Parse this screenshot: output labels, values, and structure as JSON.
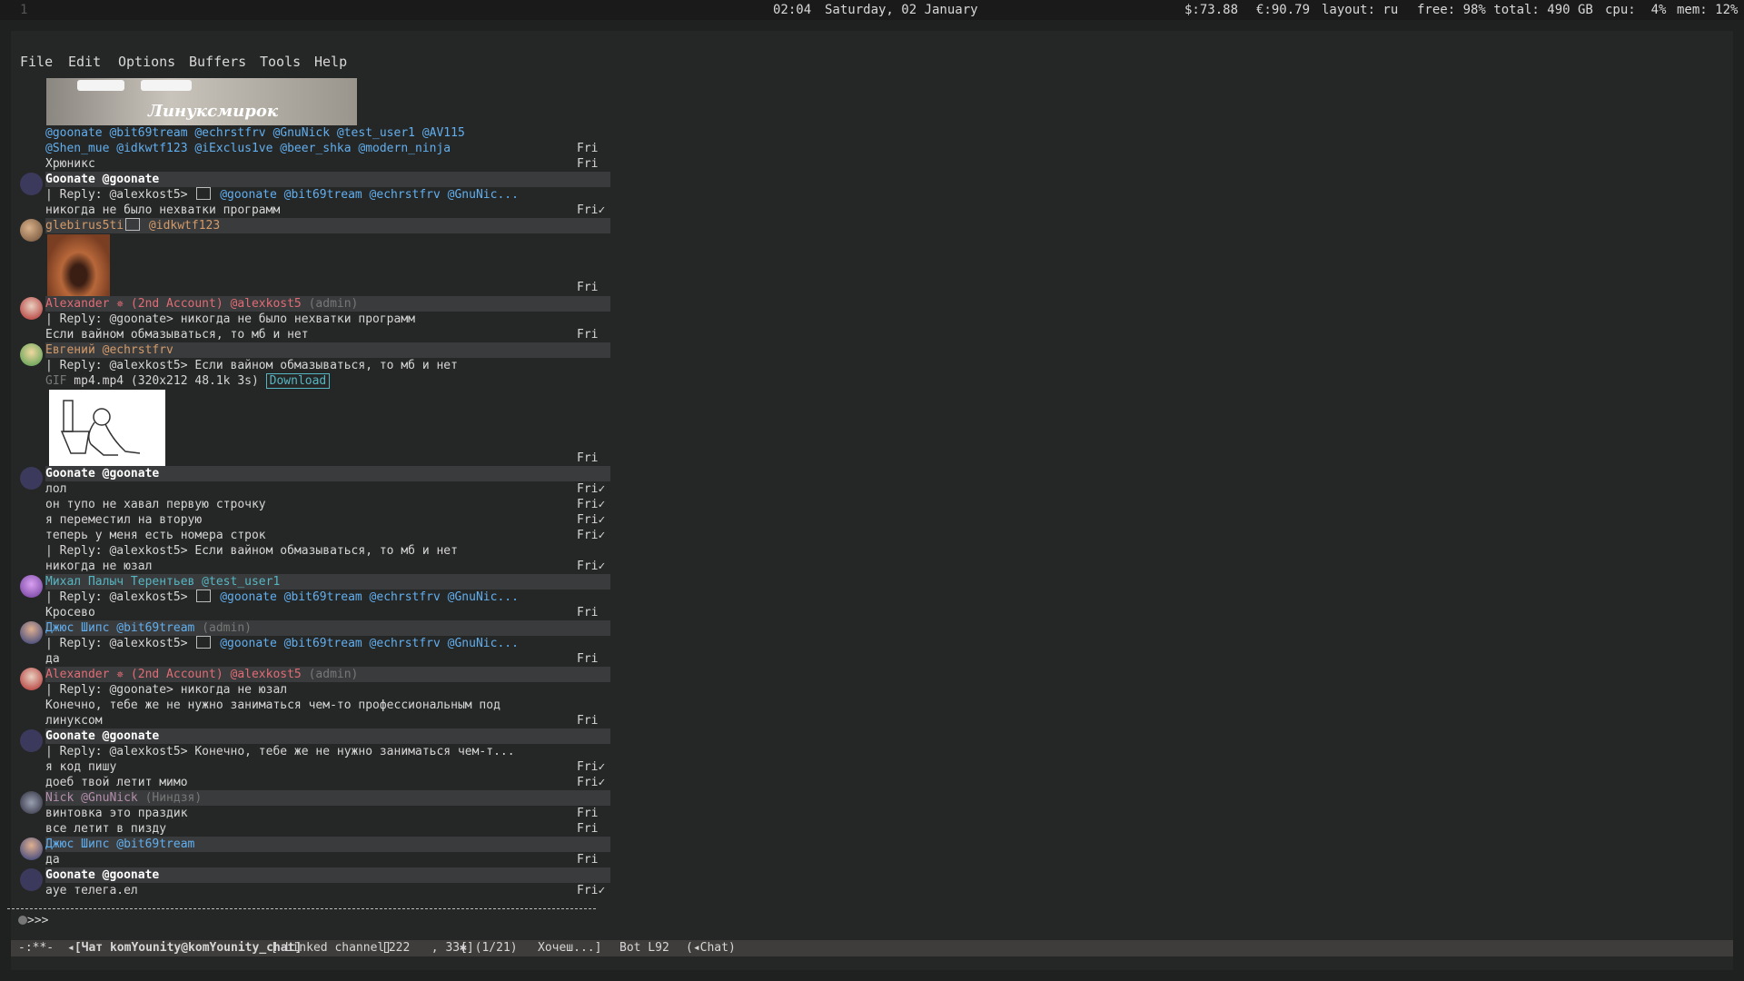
{
  "topbar": {
    "workspace": "1",
    "time": "02:04",
    "date": "Saturday, 02 January",
    "usd": "$:73.88",
    "eur": "€:90.79",
    "layout": "layout: ru",
    "disk": "free: 98% total: 490 GB",
    "cpu": "cpu:  4%",
    "mem": "mem: 12%"
  },
  "menu": [
    "File",
    "Edit",
    "Options",
    "Buffers",
    "Tools",
    "Help"
  ],
  "top_image_caption": "Линуксмирок",
  "lines": {
    "mentions1": "@goonate @bit69tream @echrstfrv @GnuNick @test_user1 @AV115",
    "mentions2": "@Shen_mue @idkwtf123 @iExclus1ve @beer_shka @modern_ninja",
    "msg_hronix": "Хрюникс",
    "hdr_goonate": "Goonate @goonate",
    "reply1_prefix": "| Reply: @alexkost5> ",
    "reply1_mentions": " @goonate @bit69tream @echrstfrv @GnuNic...",
    "msg_nikogda": "никогда не было нехватки программ",
    "hdr_glebirus": "glebirus5ti",
    "hdr_glebirus_mention": " @idkwtf123",
    "hdr_alex": "Alexander ✵ (2nd Account) @alexkost5",
    "admin": " (admin)",
    "reply2": "| Reply: @goonate> никогда не было нехватки программ",
    "msg_vaynom": "Если вайном обмазываться, то мб и нет",
    "hdr_evgeniy": "Евгений @echrstfrv",
    "reply3": "| Reply: @alexkost5> Если вайном обмазываться, то мб и нет",
    "gif_label": "GIF",
    "gif_info": " mp4.mp4 (320x212 48.1k 3s) ",
    "download": "Download",
    "msg_lol": "лол",
    "msg_tupo": "он тупо не хавал первую строчку",
    "msg_peremestil": "я переместил на вторую",
    "msg_nomera": "теперь у меня есть номера строк",
    "reply4": "| Reply: @alexkost5> Если вайном обмазываться, то мб и нет",
    "msg_yuzal": "никогда не юзал",
    "hdr_mikhal": "Михал Палыч Терентьев @test_user1",
    "msg_krosevo": "Кросево",
    "hdr_jus": "Джюс Шипс @bit69tream",
    "msg_da": "да",
    "reply5": "| Reply: @goonate> никогда не юзал",
    "msg_konechno1": "Конечно, тебе же не нужно заниматься чем-то профессиональным под",
    "msg_konechno2": "линуксом",
    "reply6": "| Reply: @alexkost5> Конечно, тебе же не нужно заниматься чем-т...",
    "msg_kod": "я код пишу",
    "msg_doeb": "доеб твой летит мимо",
    "hdr_nick": "Nick @GnuNick",
    "nick_title": " (Ниндзя)",
    "msg_vintovka": "винтовка это праздик",
    "msg_vse": "все летит в пизду",
    "msg_aue": "ауе телега.ел"
  },
  "times": {
    "fri": "Fri",
    "fri_read": "Fri✓"
  },
  "divider": "------------------------------------------------------------------------------------------------",
  "prompt": ">>>",
  "modeline": {
    "state": "-:**-",
    "buffer": "◂[Чат komYounity@komYounity_chat]",
    "linked": "[ Linked channel]",
    "counts": "[222   , 33✱]",
    "pager": "[ (1/21) ",
    "draft": "Хочеш...]",
    "position": "Bot L92",
    "mode": "(◂Chat)"
  },
  "colors": {
    "background": "#252626",
    "header_bg": "#3a3b3c",
    "mention": "#61afef"
  }
}
